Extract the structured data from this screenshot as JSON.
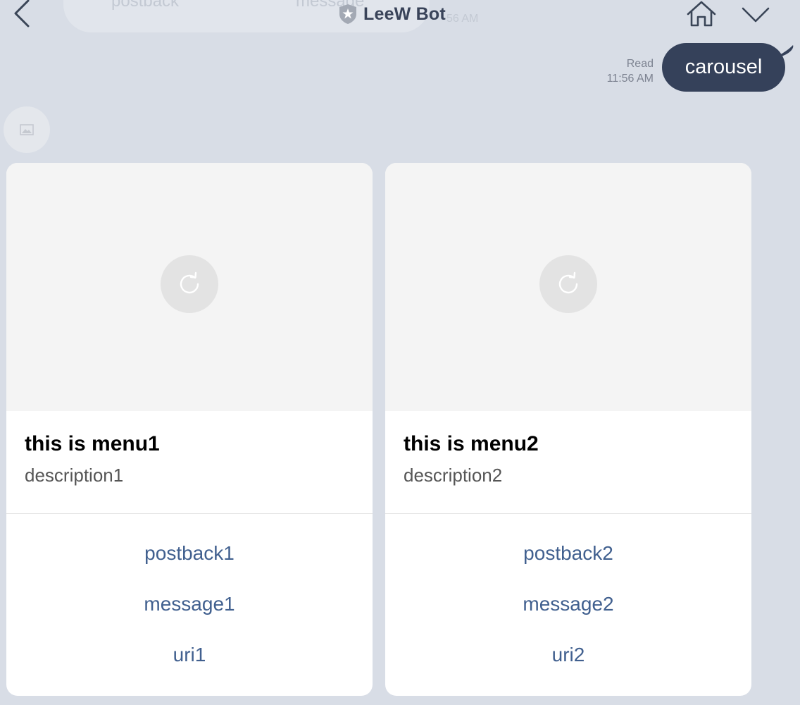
{
  "header": {
    "title": "LeeW Bot",
    "icons": {
      "back": "chevron-left-icon",
      "verified": "shield-star-icon",
      "home": "home-icon",
      "menu": "chevron-down-icon"
    }
  },
  "background_message": {
    "text_left": "postback",
    "text_right": "message",
    "time": "56 AM"
  },
  "sent_message": {
    "status": "Read",
    "time": "11:56 AM",
    "text": "carousel"
  },
  "carousel": {
    "cards": [
      {
        "title": "this is menu1",
        "description": "description1",
        "actions": [
          "postback1",
          "message1",
          "uri1"
        ]
      },
      {
        "title": "this is menu2",
        "description": "description2",
        "actions": [
          "postback2",
          "message2",
          "uri2"
        ]
      }
    ]
  },
  "colors": {
    "background": "#d8dde6",
    "sent_bubble": "#35415a",
    "action_link": "#41608f",
    "header_text": "#394359"
  }
}
